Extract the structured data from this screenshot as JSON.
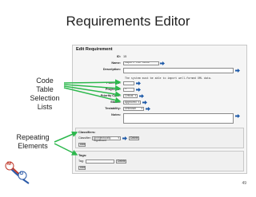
{
  "slide": {
    "title": "Requirements Editor",
    "page_number": "49",
    "annotation_code_tables": [
      "Code",
      "Table",
      "Selection",
      "Lists"
    ],
    "annotation_repeating": [
      "Repeating",
      "Elements"
    ],
    "logo_letters": [
      "M",
      "D"
    ]
  },
  "editor": {
    "title": "Edit Requirement",
    "fields": {
      "id_label": "ID:",
      "id_value": "15",
      "name_label": "Name:",
      "name_value": "Import MIL Data",
      "description_label": "Description:",
      "description_value": "The system must be able to import well-formed XML data.",
      "parent_id_label": "Parent ID:",
      "parent_id_value": "",
      "project_id_label": "Project ID:",
      "project_id_value": "1",
      "priority_label": "Priority Code:",
      "priority_value": "Critical",
      "status_label": "Status:",
      "status_value": "Approved",
      "testability_label": "Testability:",
      "testability_value": "Unknown",
      "notes_label": "Notes:",
      "notes_value": ""
    },
    "classifiers": {
      "title": "Classifiers:",
      "row_label": "Classifier:",
      "row_value": "Architecturally Significant",
      "delete_label": "Delete",
      "add_label": "Add"
    },
    "tags": {
      "title": "Tags:",
      "row_label": "Tag:",
      "row_value": "",
      "delete_label": "Delete",
      "add_label": "Add"
    }
  },
  "colors": {
    "arrow": "#2db84d",
    "go_arrow": "#1e5aa8",
    "logo_m": "#c0392b",
    "logo_d": "#2b5aa8"
  }
}
